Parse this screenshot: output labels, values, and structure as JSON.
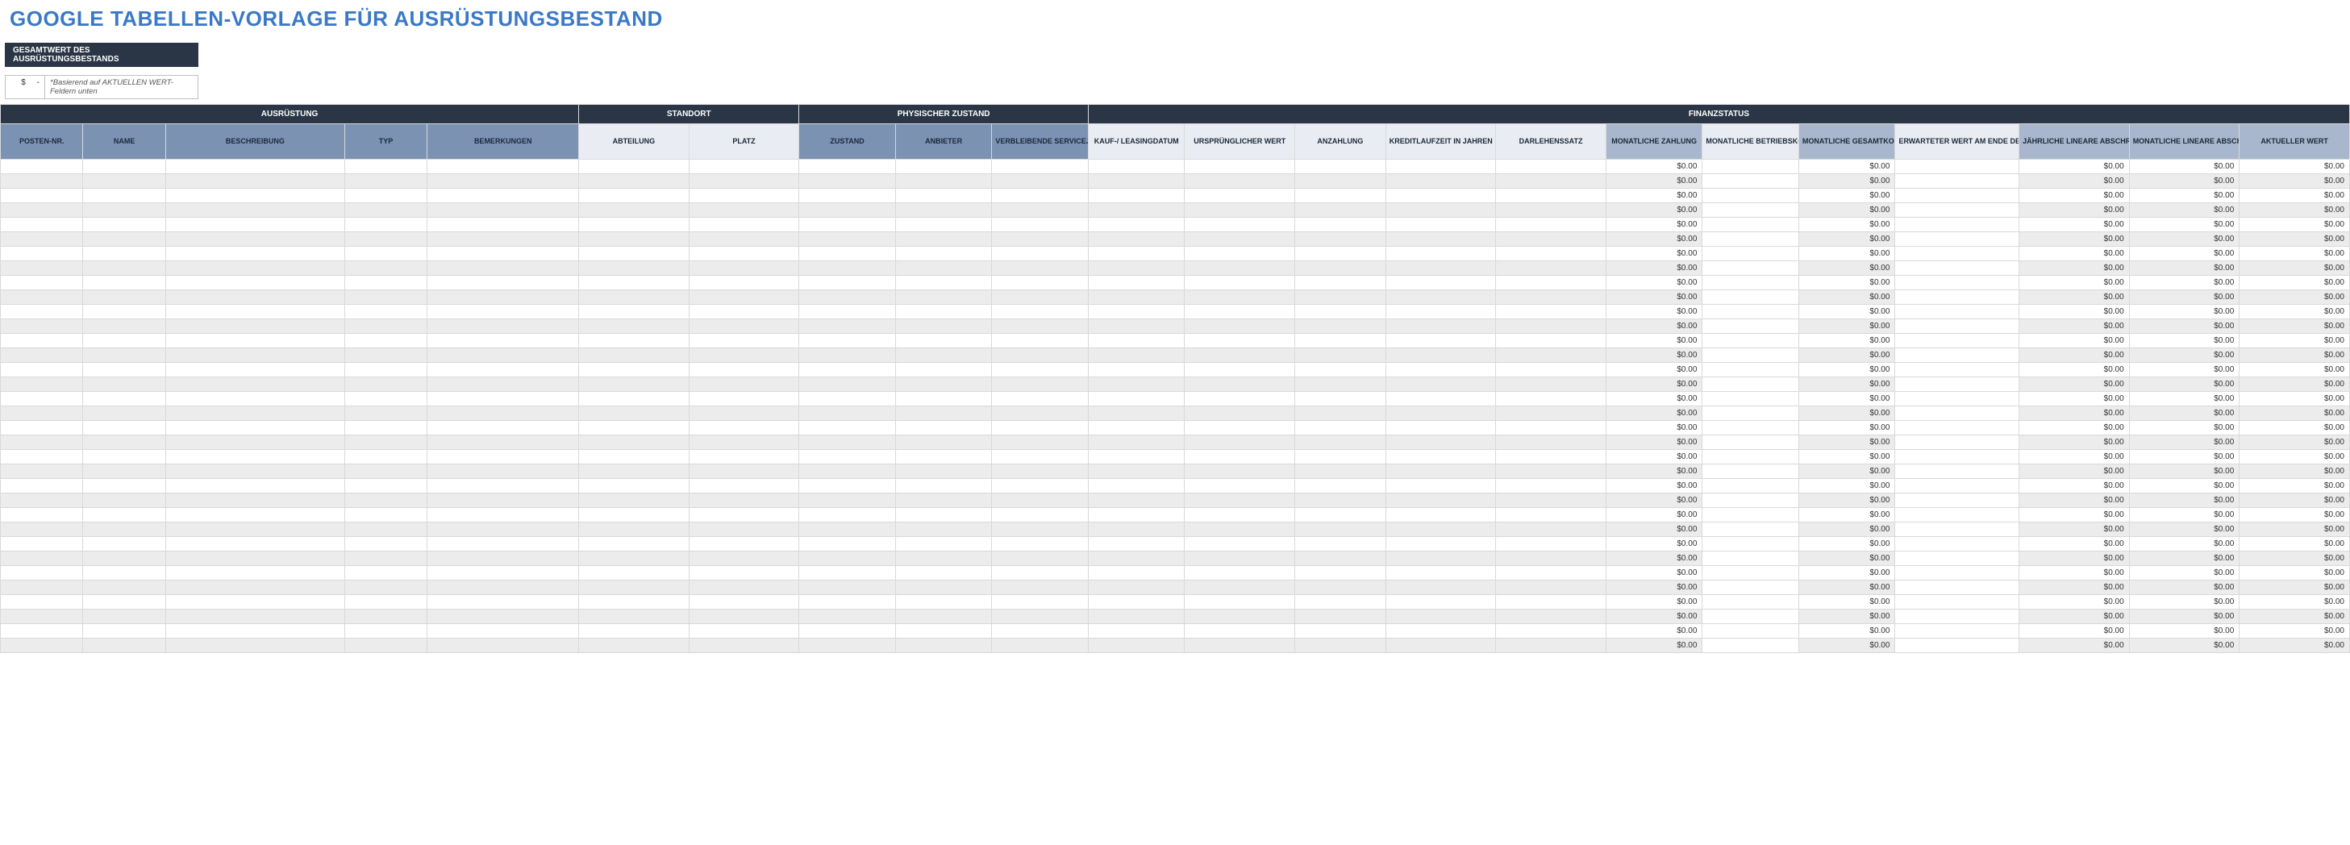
{
  "title": "GOOGLE TABELLEN-VORLAGE FÜR AUSRÜSTUNGSBESTAND",
  "summary": {
    "label": "GESAMTWERT DES AUSRÜSTUNGSBESTANDS",
    "currency": "$",
    "value": "-",
    "note": "*Basierend auf AKTUELLEN WERT-Feldern unten"
  },
  "groups": [
    {
      "label": "AUSRÜSTUNG",
      "span": 5,
      "style": "dark"
    },
    {
      "label": "STANDORT",
      "span": 2,
      "style": "dark"
    },
    {
      "label": "PHYSISCHER ZUSTAND",
      "span": 3,
      "style": "dark"
    },
    {
      "label": "FINANZSTATUS",
      "span": 12,
      "style": "dark"
    }
  ],
  "columns": [
    {
      "label": "POSTEN-NR.",
      "style": "blue"
    },
    {
      "label": "NAME",
      "style": "blue"
    },
    {
      "label": "BESCHREIBUNG",
      "style": "blue"
    },
    {
      "label": "TYP",
      "style": "blue"
    },
    {
      "label": "BEMERKUNGEN",
      "style": "blue"
    },
    {
      "label": "ABTEILUNG",
      "style": "light"
    },
    {
      "label": "PLATZ",
      "style": "light"
    },
    {
      "label": "ZUSTAND",
      "style": "blue"
    },
    {
      "label": "ANBIETER",
      "style": "blue"
    },
    {
      "label": "VERBLEIBENDE SERVICEJAHRE",
      "style": "blue"
    },
    {
      "label": "KAUF-/ LEASINGDATUM",
      "style": "light"
    },
    {
      "label": "URSPRÜNGLICHER WERT",
      "style": "light"
    },
    {
      "label": "ANZAHLUNG",
      "style": "light"
    },
    {
      "label": "KREDITLAUFZEIT IN JAHREN",
      "style": "light"
    },
    {
      "label": "DARLEHENSSATZ",
      "style": "light"
    },
    {
      "label": "MONATLICHE ZAHLUNG",
      "style": "steel"
    },
    {
      "label": "MONATLICHE BETRIEBSKOSTEN",
      "style": "light"
    },
    {
      "label": "MONATLICHE GESAMTKOSTEN",
      "style": "steel"
    },
    {
      "label": "ERWARTETER WERT AM ENDE DER KREDITLAUFZEIT",
      "style": "light"
    },
    {
      "label": "JÄHRLICHE LINEARE ABSCHREIBUNG",
      "style": "steel"
    },
    {
      "label": "MONATLICHE LINEARE ABSCHREIBUNG",
      "style": "steel"
    },
    {
      "label": "AKTUELLER WERT",
      "style": "steel"
    }
  ],
  "row_count": 34,
  "financial_default": "$0.00",
  "financial_columns": [
    15,
    17,
    19,
    20,
    21
  ],
  "white_override_columns": [
    16,
    18
  ]
}
